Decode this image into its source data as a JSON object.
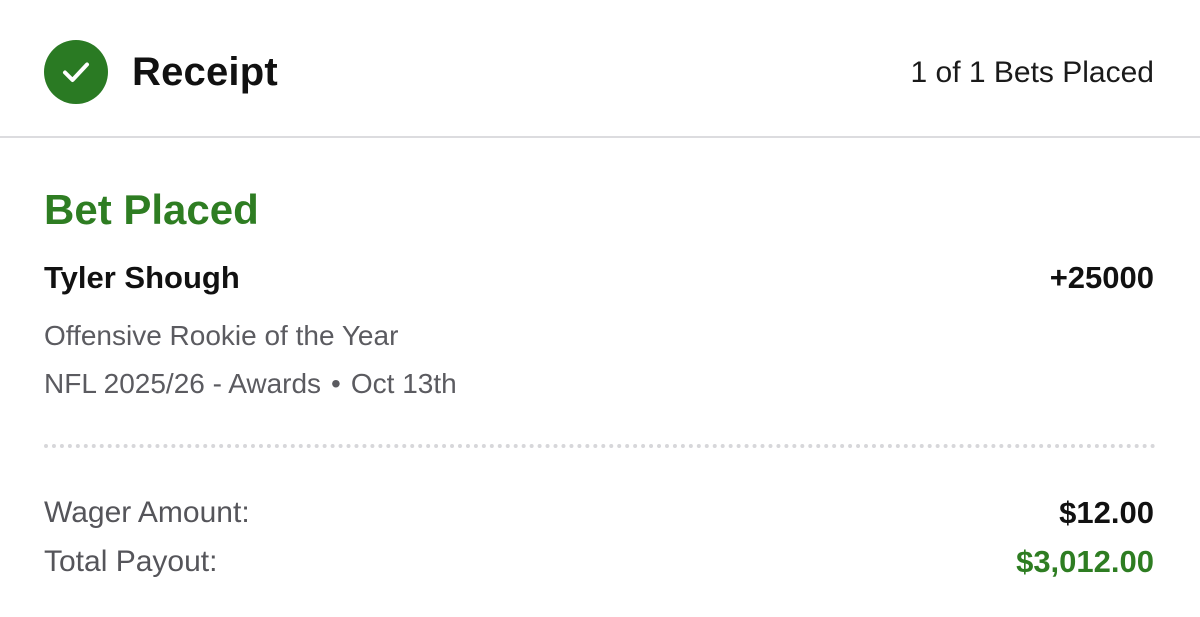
{
  "header": {
    "title": "Receipt",
    "bets_placed": "1 of 1 Bets Placed",
    "status_icon": "check-circle-icon"
  },
  "bet": {
    "status": "Bet Placed",
    "selection": "Tyler Shough",
    "odds": "+25000",
    "market": "Offensive Rookie of the Year",
    "event": "NFL 2025/26 - Awards",
    "separator": "•",
    "date": "Oct 13th"
  },
  "summary": {
    "wager_label": "Wager Amount:",
    "wager_value": "$12.00",
    "payout_label": "Total Payout:",
    "payout_value": "$3,012.00"
  },
  "colors": {
    "accent_green": "#2e7d22",
    "check_circle": "#2a7a23"
  }
}
